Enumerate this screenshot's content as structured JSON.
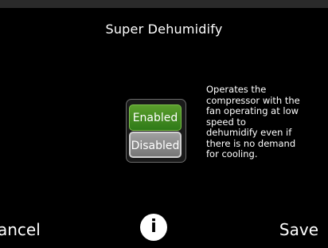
{
  "screen": {
    "title": "Super Dehumidify"
  },
  "toggle": {
    "enabled_label": "Enabled",
    "disabled_label": "Disabled",
    "selected": "Disabled"
  },
  "description": "Operates the\ncompressor with the\nfan operating at low\nspeed to\ndehumidify even if\nthere is no demand\nfor cooling.",
  "footer": {
    "cancel_label": "Cancel",
    "info_icon": "i",
    "save_label": "Save"
  },
  "colors": {
    "enabled_accent": "#3f8a22",
    "disabled_accent": "#8a8a8a"
  }
}
